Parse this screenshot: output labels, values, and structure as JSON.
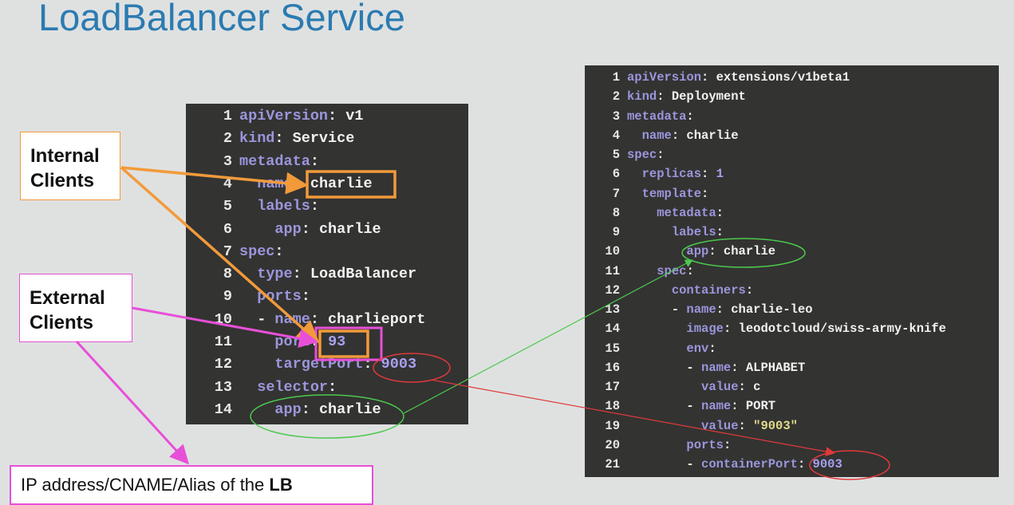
{
  "title": "LoadBalancer Service",
  "labels": {
    "internal_clients": "Internal Clients",
    "external_clients": "External Clients",
    "lb_text": "IP address/CNAME/Alias of the ",
    "lb_bold": "LB"
  },
  "colors": {
    "internal": "#f29a3a",
    "external": "#e84fd8",
    "selector_link": "#4cc94c",
    "port_link": "#e03a3a",
    "title": "#2b7bb1"
  },
  "service_yaml": [
    {
      "n": "1",
      "tokens": [
        [
          "k",
          "apiVersion"
        ],
        [
          "v",
          ": v1"
        ]
      ]
    },
    {
      "n": "2",
      "tokens": [
        [
          "k",
          "kind"
        ],
        [
          "v",
          ": Service"
        ]
      ]
    },
    {
      "n": "3",
      "tokens": [
        [
          "k",
          "metadata"
        ],
        [
          "v",
          ":"
        ]
      ]
    },
    {
      "n": "4",
      "tokens": [
        [
          "v",
          "  "
        ],
        [
          "k",
          "name"
        ],
        [
          "v",
          ": charlie"
        ]
      ]
    },
    {
      "n": "5",
      "tokens": [
        [
          "v",
          "  "
        ],
        [
          "k",
          "labels"
        ],
        [
          "v",
          ":"
        ]
      ]
    },
    {
      "n": "6",
      "tokens": [
        [
          "v",
          "    "
        ],
        [
          "k",
          "app"
        ],
        [
          "v",
          ": charlie"
        ]
      ]
    },
    {
      "n": "7",
      "tokens": [
        [
          "k",
          "spec"
        ],
        [
          "v",
          ":"
        ]
      ]
    },
    {
      "n": "8",
      "tokens": [
        [
          "v",
          "  "
        ],
        [
          "k",
          "type"
        ],
        [
          "v",
          ": LoadBalancer"
        ]
      ]
    },
    {
      "n": "9",
      "tokens": [
        [
          "v",
          "  "
        ],
        [
          "k",
          "ports"
        ],
        [
          "v",
          ":"
        ]
      ]
    },
    {
      "n": "10",
      "tokens": [
        [
          "v",
          "  - "
        ],
        [
          "k",
          "name"
        ],
        [
          "v",
          ": charlieport"
        ]
      ]
    },
    {
      "n": "11",
      "tokens": [
        [
          "v",
          "    "
        ],
        [
          "k",
          "port"
        ],
        [
          "v",
          ": "
        ],
        [
          "n",
          "93"
        ]
      ]
    },
    {
      "n": "12",
      "tokens": [
        [
          "v",
          "    "
        ],
        [
          "k",
          "targetPort"
        ],
        [
          "v",
          ": "
        ],
        [
          "n",
          "9003"
        ]
      ]
    },
    {
      "n": "13",
      "tokens": [
        [
          "v",
          "  "
        ],
        [
          "k",
          "selector"
        ],
        [
          "v",
          ":"
        ]
      ]
    },
    {
      "n": "14",
      "tokens": [
        [
          "v",
          "    "
        ],
        [
          "k",
          "app"
        ],
        [
          "v",
          ": charlie"
        ]
      ]
    }
  ],
  "deployment_yaml": [
    {
      "n": "1",
      "tokens": [
        [
          "k",
          "apiVersion"
        ],
        [
          "v",
          ": extensions/v1beta1"
        ]
      ]
    },
    {
      "n": "2",
      "tokens": [
        [
          "k",
          "kind"
        ],
        [
          "v",
          ": Deployment"
        ]
      ]
    },
    {
      "n": "3",
      "tokens": [
        [
          "k",
          "metadata"
        ],
        [
          "v",
          ":"
        ]
      ]
    },
    {
      "n": "4",
      "tokens": [
        [
          "v",
          "  "
        ],
        [
          "k",
          "name"
        ],
        [
          "v",
          ": charlie"
        ]
      ]
    },
    {
      "n": "5",
      "tokens": [
        [
          "k",
          "spec"
        ],
        [
          "v",
          ":"
        ]
      ]
    },
    {
      "n": "6",
      "tokens": [
        [
          "v",
          "  "
        ],
        [
          "k",
          "replicas"
        ],
        [
          "v",
          ": "
        ],
        [
          "n",
          "1"
        ]
      ]
    },
    {
      "n": "7",
      "tokens": [
        [
          "v",
          "  "
        ],
        [
          "k",
          "template"
        ],
        [
          "v",
          ":"
        ]
      ]
    },
    {
      "n": "8",
      "tokens": [
        [
          "v",
          "    "
        ],
        [
          "k",
          "metadata"
        ],
        [
          "v",
          ":"
        ]
      ]
    },
    {
      "n": "9",
      "tokens": [
        [
          "v",
          "      "
        ],
        [
          "k",
          "labels"
        ],
        [
          "v",
          ":"
        ]
      ]
    },
    {
      "n": "10",
      "tokens": [
        [
          "v",
          "        "
        ],
        [
          "k",
          "app"
        ],
        [
          "v",
          ": charlie"
        ]
      ]
    },
    {
      "n": "11",
      "tokens": [
        [
          "v",
          "    "
        ],
        [
          "k",
          "spec"
        ],
        [
          "v",
          ":"
        ]
      ]
    },
    {
      "n": "12",
      "tokens": [
        [
          "v",
          "      "
        ],
        [
          "k",
          "containers"
        ],
        [
          "v",
          ":"
        ]
      ]
    },
    {
      "n": "13",
      "tokens": [
        [
          "v",
          "      - "
        ],
        [
          "k",
          "name"
        ],
        [
          "v",
          ": charlie-leo"
        ]
      ]
    },
    {
      "n": "14",
      "tokens": [
        [
          "v",
          "        "
        ],
        [
          "k",
          "image"
        ],
        [
          "v",
          ": leodotcloud/swiss-army-knife"
        ]
      ]
    },
    {
      "n": "15",
      "tokens": [
        [
          "v",
          "        "
        ],
        [
          "k",
          "env"
        ],
        [
          "v",
          ":"
        ]
      ]
    },
    {
      "n": "16",
      "tokens": [
        [
          "v",
          "        - "
        ],
        [
          "k",
          "name"
        ],
        [
          "v",
          ": ALPHABET"
        ]
      ]
    },
    {
      "n": "17",
      "tokens": [
        [
          "v",
          "          "
        ],
        [
          "k",
          "value"
        ],
        [
          "v",
          ": c"
        ]
      ]
    },
    {
      "n": "18",
      "tokens": [
        [
          "v",
          "        - "
        ],
        [
          "k",
          "name"
        ],
        [
          "v",
          ": PORT"
        ]
      ]
    },
    {
      "n": "19",
      "tokens": [
        [
          "v",
          "          "
        ],
        [
          "k",
          "value"
        ],
        [
          "v",
          ": "
        ],
        [
          "s",
          "\"9003\""
        ]
      ]
    },
    {
      "n": "20",
      "tokens": [
        [
          "v",
          "        "
        ],
        [
          "k",
          "ports"
        ],
        [
          "v",
          ":"
        ]
      ]
    },
    {
      "n": "21",
      "tokens": [
        [
          "v",
          "        - "
        ],
        [
          "k",
          "containerPort"
        ],
        [
          "v",
          ": "
        ],
        [
          "n",
          "9003"
        ]
      ]
    }
  ]
}
